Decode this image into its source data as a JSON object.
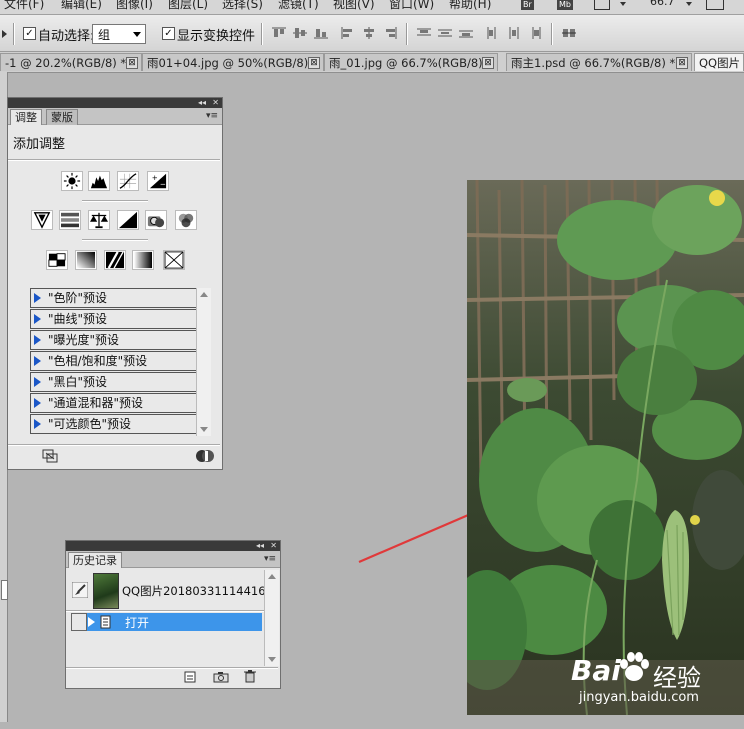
{
  "menubar": {
    "items": [
      "文件(F)",
      "编辑(E)",
      "图像(I)",
      "图层(L)",
      "选择(S)",
      "滤镜(T)",
      "视图(V)",
      "窗口(W)",
      "帮助(H)"
    ],
    "badges": [
      "Br",
      "Mb"
    ],
    "zoom": "66.7"
  },
  "options": {
    "auto_select_label": "自动选择:",
    "auto_select_checked": "✓",
    "auto_select_value": "组",
    "show_transform_label": "显示变换控件",
    "show_transform_checked": "✓"
  },
  "tabs": [
    {
      "label": "-1 @ 20.2%(RGB/8) *",
      "close": "⊠"
    },
    {
      "label": "雨01+04.jpg @ 50%(RGB/8)",
      "close": "⊠"
    },
    {
      "label": "雨_01.jpg @ 66.7%(RGB/8)",
      "close": "⊠"
    },
    {
      "label": "雨主1.psd @ 66.7%(RGB/8) *",
      "close": "⊠"
    },
    {
      "label": "QQ图片",
      "close": ""
    }
  ],
  "adjustments_panel": {
    "tab_adjust": "调整",
    "tab_masks": "蒙版",
    "heading": "添加调整",
    "collapse": "◂◂",
    "close": "✕",
    "menu": "▾≡",
    "presets": [
      "\"色阶\"预设",
      "\"曲线\"预设",
      "\"曝光度\"预设",
      "\"色相/饱和度\"预设",
      "\"黑白\"预设",
      "\"通道混和器\"预设",
      "\"可选颜色\"预设"
    ]
  },
  "history_panel": {
    "tab": "历史记录",
    "collapse": "◂◂",
    "close": "✕",
    "menu": "▾≡",
    "snapshot_label": "QQ图片20180331114416...",
    "step_label": "打开"
  },
  "watermark": {
    "brand_left": "Bai",
    "brand_right": "经验",
    "url": "jingyan.baidu.com"
  },
  "colors": {
    "accent": "#3d95ea",
    "arrow": "#e0393a",
    "canvas_bg": "#b4b4b4"
  }
}
